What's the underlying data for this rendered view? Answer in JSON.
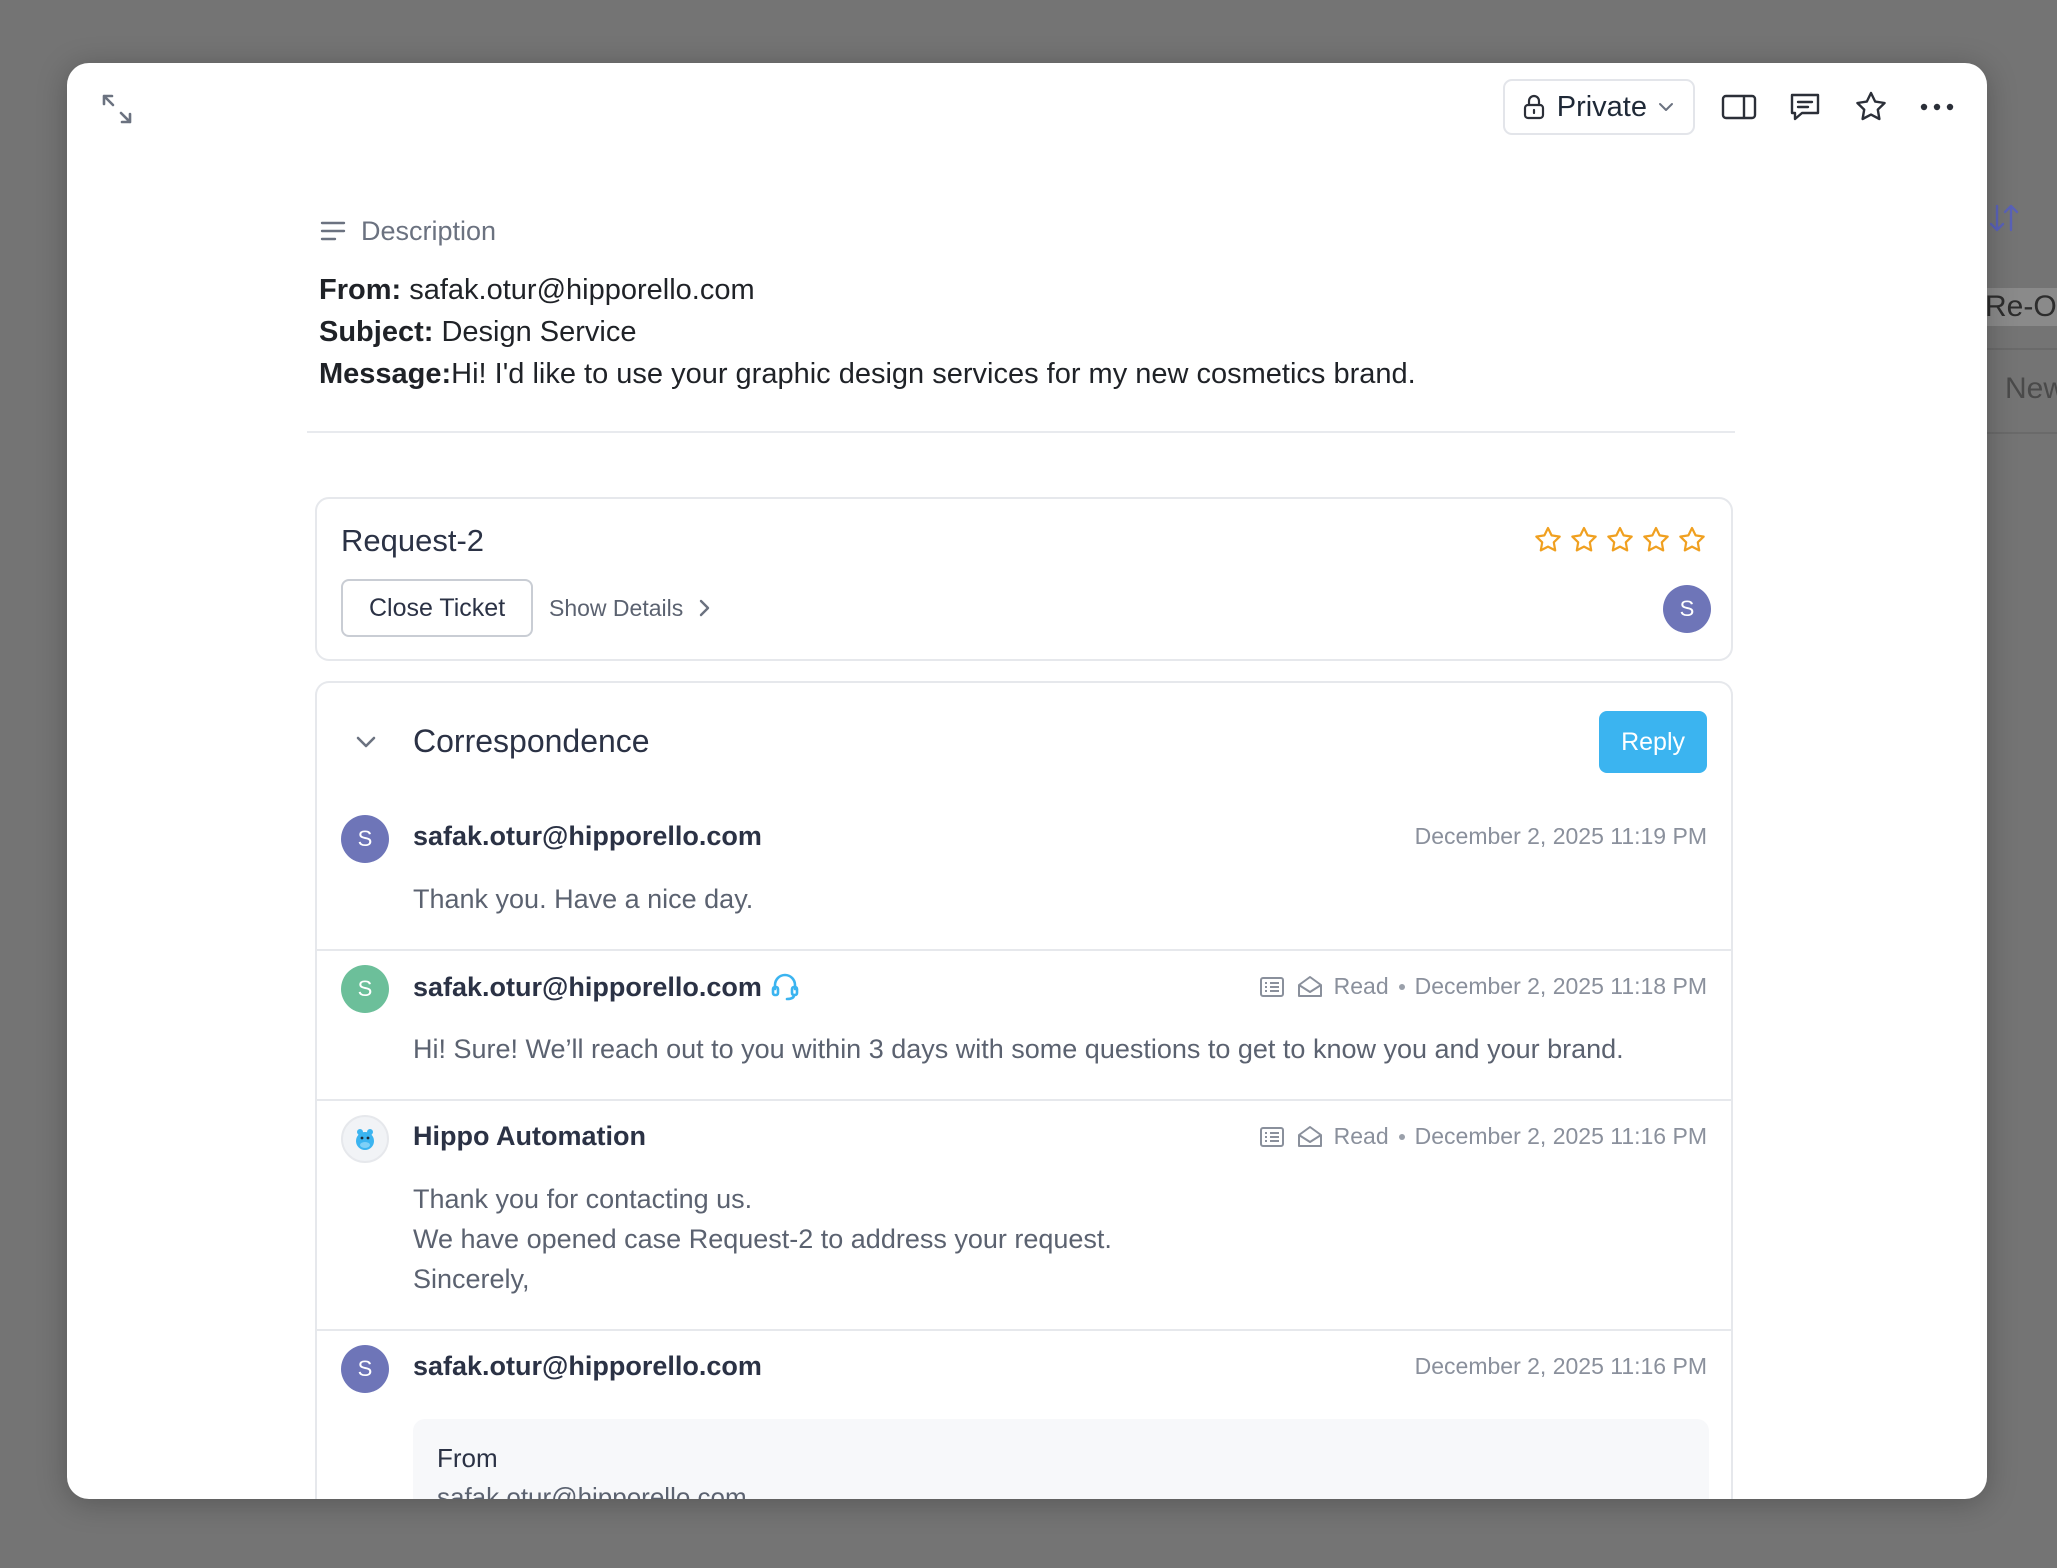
{
  "background": {
    "tag_text": "Re-Op",
    "new_text": "New"
  },
  "topbar": {
    "privacy_label": "Private",
    "icons": [
      "lock-icon",
      "chevron-down-icon",
      "side-panel-icon",
      "comment-icon",
      "star-icon",
      "more-icon"
    ]
  },
  "description": {
    "heading": "Description",
    "from_label": "From:",
    "from_value": "safak.otur@hipporello.com",
    "subject_label": "Subject:",
    "subject_value": "Design Service",
    "message_label": "Message:",
    "message_value": "Hi! I'd like to use your graphic design services for my new cosmetics brand."
  },
  "ticket": {
    "title": "Request-2",
    "close_label": "Close Ticket",
    "details_label": "Show Details",
    "rating": 0,
    "rating_max": 5,
    "assignee_initial": "S",
    "colors": {
      "star": "#f0a020",
      "avatar": "#6e75b8"
    }
  },
  "correspondence": {
    "title": "Correspondence",
    "reply_label": "Reply",
    "reply_color": "#3bb4f0",
    "messages": [
      {
        "initial": "S",
        "avatar_color": "#6e75b8",
        "sender": "safak.otur@hipporello.com",
        "status": "",
        "timestamp": "December 2, 2025 11:19 PM",
        "lines": [
          "Thank you. Have a nice day."
        ]
      },
      {
        "initial": "S",
        "avatar_color": "#6cbf9a",
        "sender": "safak.otur@hipporello.com",
        "status": "Read",
        "timestamp": "December 2, 2025 11:18 PM",
        "lines": [
          "Hi! Sure! We’ll reach out to you within 3 days with some questions to get to know you and your brand."
        ]
      },
      {
        "initial": "",
        "avatar_color": "#f1f3f6",
        "sender": "Hippo Automation",
        "status": "Read",
        "timestamp": "December 2, 2025 11:16 PM",
        "lines": [
          "Thank you for contacting us.",
          "We have opened case Request-2 to address your request.",
          "Sincerely,"
        ]
      },
      {
        "initial": "S",
        "avatar_color": "#6e75b8",
        "sender": "safak.otur@hipporello.com",
        "status": "",
        "timestamp": "December 2, 2025 11:16 PM",
        "quote_label": "From",
        "quote_value": "safak.otur@hipporello.com"
      }
    ]
  }
}
